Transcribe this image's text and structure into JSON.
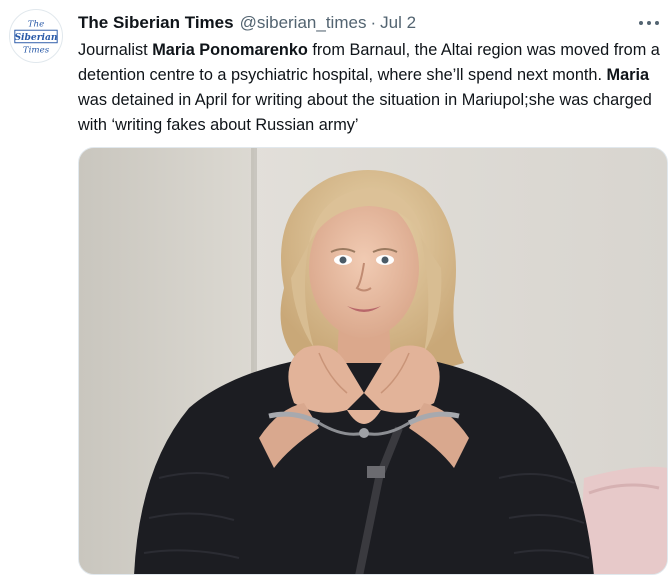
{
  "tweet": {
    "author_name": "The Siberian Times",
    "handle": "@siberian_times",
    "separator": "·",
    "date": "Jul 2",
    "text": {
      "p1": "Journalist ",
      "b1": "Maria Ponomarenko",
      "p2": " from Barnaul, the Altai region was moved from a detention centre to a psychiatric hospital, where she’ll spend next month. ",
      "b2": "Maria",
      "p3": " was detained in April for writing about the situation in Mariupol;she was charged with ‘writing fakes about Russian army’"
    }
  },
  "avatar": {
    "logo_line1": "The",
    "logo_line2": "Siberian",
    "logo_line3": "Times"
  },
  "icons": {
    "more": "more-options-icon"
  },
  "colors": {
    "text_primary": "#0f1419",
    "text_secondary": "#536471",
    "logo_blue": "#2a5aa8"
  }
}
